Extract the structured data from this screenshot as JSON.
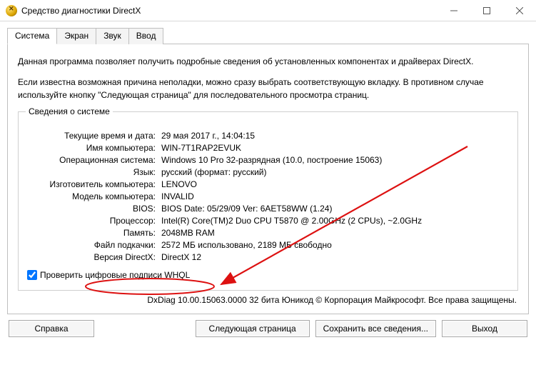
{
  "window": {
    "title": "Средство диагностики DirectX"
  },
  "tabs": [
    {
      "label": "Система",
      "active": true
    },
    {
      "label": "Экран",
      "active": false
    },
    {
      "label": "Звук",
      "active": false
    },
    {
      "label": "Ввод",
      "active": false
    }
  ],
  "intro": {
    "line1": "Данная программа позволяет получить подробные сведения об установленных компонентах и драйверах DirectX.",
    "line2": "Если известна возможная причина неполадки, можно сразу выбрать соответствующую вкладку. В противном случае используйте кнопку \"Следующая страница\" для последовательного просмотра страниц."
  },
  "groupbox": {
    "legend": "Сведения о системе"
  },
  "system_rows": [
    {
      "label": "Текущие время и дата:",
      "value": "29 мая 2017 г., 14:04:15"
    },
    {
      "label": "Имя компьютера:",
      "value": "WIN-7T1RAP2EVUK"
    },
    {
      "label": "Операционная система:",
      "value": "Windows 10 Pro 32-разрядная (10.0, построение 15063)"
    },
    {
      "label": "Язык:",
      "value": "русский (формат: русский)"
    },
    {
      "label": "Изготовитель компьютера:",
      "value": "LENOVO"
    },
    {
      "label": "Модель компьютера:",
      "value": "INVALID"
    },
    {
      "label": "BIOS:",
      "value": "BIOS Date: 05/29/09  Ver: 6AET58WW (1.24)"
    },
    {
      "label": "Процессор:",
      "value": "Intel(R) Core(TM)2 Duo CPU    T5870   @ 2.00GHz (2 CPUs), ~2.0GHz"
    },
    {
      "label": "Память:",
      "value": "2048MB RAM"
    },
    {
      "label": "Файл подкачки:",
      "value": "2572 МБ использовано, 2189 МБ свободно"
    },
    {
      "label": "Версия DirectX:",
      "value": "DirectX 12"
    }
  ],
  "whql": {
    "label": "Проверить цифровые подписи WHQL",
    "checked": true
  },
  "copyright": "DxDiag 10.00.15063.0000 32 бита Юникод © Корпорация Майкрософт. Все права защищены.",
  "buttons": {
    "help": "Справка",
    "next": "Следующая страница",
    "save": "Сохранить все сведения...",
    "exit": "Выход"
  }
}
